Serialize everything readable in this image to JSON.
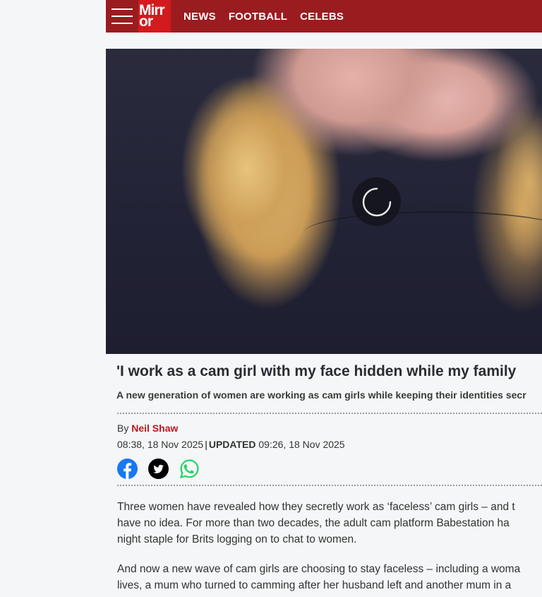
{
  "header": {
    "logo_line1": "Mirr",
    "logo_line2": "or",
    "nav": [
      "NEWS",
      "FOOTBALL",
      "CELEBS"
    ]
  },
  "article": {
    "headline": "'I work as a cam girl with my face hidden while my family",
    "standfirst": "A new generation of women are working as cam girls while keeping their identities secr",
    "byline_prefix": "By",
    "author": "Neil Shaw",
    "published": "08:38, 18 Nov 2025",
    "separator": "|",
    "updated_label": "UPDATED",
    "updated": "09:26, 18 Nov 2025",
    "paragraph1": [
      "Three women have revealed how they secretly work as ‘faceless’ cam girls – and t",
      "have no idea. For more than two decades, the adult cam platform Babestation ha",
      "night staple for Brits logging on to chat to women."
    ],
    "paragraph2": [
      "And now a new wave of cam girls are choosing to stay faceless – including a woma",
      "lives, a mum who turned to camming after her husband left and another mum in a"
    ]
  },
  "share": {
    "facebook_color": "#1877f2",
    "twitter_color": "#000000",
    "whatsapp_color": "#25d366"
  },
  "colors": {
    "brand": "#9b1c1f",
    "logo_bg": "#d21a1f",
    "link": "#c0161c"
  }
}
